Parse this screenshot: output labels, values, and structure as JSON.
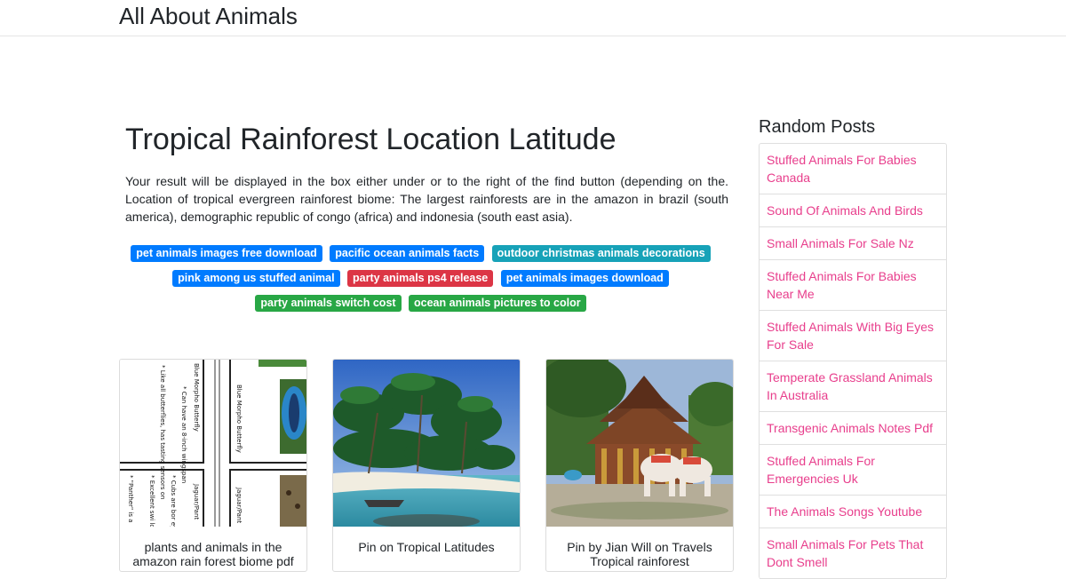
{
  "header": {
    "brand": "All About Animals"
  },
  "article": {
    "title": "Tropical Rainforest Location Latitude",
    "summary": "Your result will be displayed in the box either under or to the right of the find button (depending on the. Location of tropical evergreen rainforest biome: The largest rainforests are in the amazon in brazil (south america), demographic republic of congo (africa) and indonesia (south east asia)."
  },
  "tags": [
    {
      "label": "pet animals images free download",
      "color": "#007bff"
    },
    {
      "label": "pacific ocean animals facts",
      "color": "#007bff"
    },
    {
      "label": "outdoor christmas animals decorations",
      "color": "#17a2b8"
    },
    {
      "label": "pink among us stuffed animal",
      "color": "#007bff"
    },
    {
      "label": "party animals ps4 release",
      "color": "#dc3545"
    },
    {
      "label": "pet animals images download",
      "color": "#007bff"
    },
    {
      "label": "party animals switch cost",
      "color": "#28a745"
    },
    {
      "label": "ocean animals pictures to color",
      "color": "#28a745"
    }
  ],
  "cards": [
    {
      "caption": "plants and animals in the amazon rain forest biome pdf"
    },
    {
      "caption": "Pin on Tropical Latitudes"
    },
    {
      "caption": "Pin by Jian Will on Travels Tropical rainforest"
    }
  ],
  "card_images": {
    "card1_texts": [
      "Blue Morpho Butterfly",
      "* Can have an 8-inch wingspan",
      "* Like all butterflies, has tasting sensors on",
      "Jaguar/Pant",
      "* Cubs are bor eyes and ears c",
      "* Excellent swi love wate",
      "* \"Panther\" is a",
      "Blue Morpho Butterfly",
      "Jaguar/Pant"
    ]
  },
  "sidebar": {
    "title": "Random Posts",
    "items": [
      "Stuffed Animals For Babies Canada",
      "Sound Of Animals And Birds",
      "Small Animals For Sale Nz",
      "Stuffed Animals For Babies Near Me",
      "Stuffed Animals With Big Eyes For Sale",
      "Temperate Grassland Animals In Australia",
      "Transgenic Animals Notes Pdf",
      "Stuffed Animals For Emergencies Uk",
      "The Animals Songs Youtube",
      "Small Animals For Pets That Dont Smell"
    ]
  },
  "colors": {
    "link": "#e83e8c",
    "border": "#dfdfdf"
  }
}
